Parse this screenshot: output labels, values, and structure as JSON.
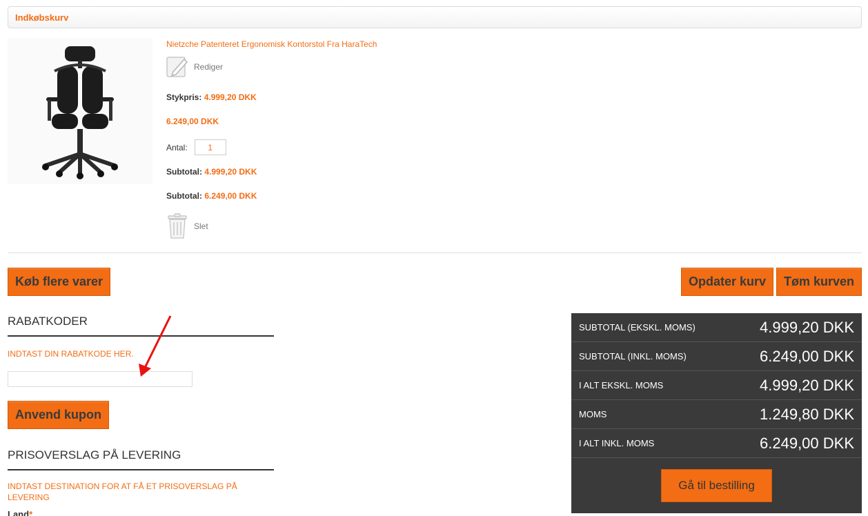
{
  "header": {
    "title": "Indkøbskurv"
  },
  "product": {
    "name": "Nietzche Patenteret Ergonomisk Kontorstol Fra HaraTech",
    "edit_label": "Rediger",
    "unit_price_label": "Stykpris:",
    "unit_price": "4.999,20 DKK",
    "unit_price_incl": "6.249,00 DKK",
    "qty_label": "Antal:",
    "qty_value": "1",
    "subtotal_label": "Subtotal:",
    "subtotal_excl": "4.999,20 DKK",
    "subtotal_incl": "6.249,00 DKK",
    "delete_label": "Slet"
  },
  "actions": {
    "continue_shopping": "Køb flere varer",
    "update_cart": "Opdater kurv",
    "empty_cart": "Tøm kurven"
  },
  "discount": {
    "title": "RABATKODER",
    "hint": "INDTAST DIN RABATKODE HER.",
    "input_value": "",
    "apply_button": "Anvend kupon"
  },
  "shipping": {
    "title": "PRISOVERSLAG PÅ LEVERING",
    "hint": "INDTAST DESTINATION FOR AT FÅ ET PRISOVERSLAG PÅ LEVERING",
    "country_label": "Land",
    "required_mark": "*"
  },
  "totals": {
    "rows": [
      {
        "label": "SUBTOTAL (EKSKL. MOMS)",
        "amount": "4.999,20 DKK"
      },
      {
        "label": "SUBTOTAL (INKL. MOMS)",
        "amount": "6.249,00 DKK"
      },
      {
        "label": "I ALT EKSKL. MOMS",
        "amount": "4.999,20 DKK"
      },
      {
        "label": "MOMS",
        "amount": "1.249,80 DKK"
      },
      {
        "label": "I ALT INKL. MOMS",
        "amount": "6.249,00 DKK"
      }
    ],
    "checkout_button": "Gå til bestilling"
  },
  "colors": {
    "accent": "#f26d14",
    "totals_bg": "#3a3a3a",
    "annotation_arrow": "#e8130f"
  },
  "icons": [
    "edit-icon",
    "trash-icon",
    "arrow-annotation"
  ]
}
